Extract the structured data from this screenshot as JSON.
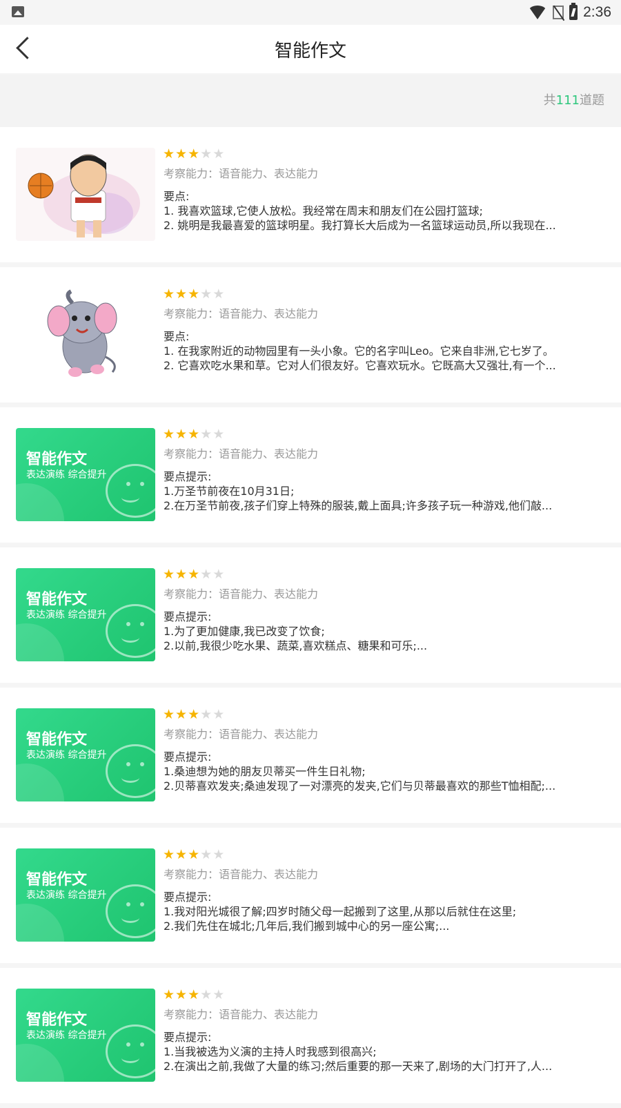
{
  "status_bar": {
    "time": "2:36",
    "icons": [
      "gallery-icon",
      "wifi-icon",
      "no-sim-icon",
      "battery-icon"
    ]
  },
  "header": {
    "title": "智能作文",
    "back_icon": "chevron-left-icon"
  },
  "summary": {
    "prefix": "共",
    "count": "111",
    "suffix": "道题"
  },
  "colors": {
    "accent": "#2ec77d",
    "star_active": "#f6b400",
    "star_inactive": "#d9d9d9"
  },
  "items": [
    {
      "thumb_type": "basketball-player-illustration",
      "rating": 3,
      "rating_max": 5,
      "skills": "考察能力：语音能力、表达能力",
      "heading": "要点:",
      "line1": "1. 我喜欢篮球,它使人放松。我经常在周末和朋友们在公园打篮球;",
      "line2": "2. 姚明是我最喜爱的篮球明星。我打算长大后成为一名篮球运动员,所以我现在..."
    },
    {
      "thumb_type": "elephant-illustration",
      "rating": 3,
      "rating_max": 5,
      "skills": "考察能力：语音能力、表达能力",
      "heading": "要点:",
      "line1": "1. 在我家附近的动物园里有一头小象。它的名字叫Leo。它来自非洲,它七岁了。",
      "line2": "2. 它喜欢吃水果和草。它对人们很友好。它喜欢玩水。它既高大又强壮,有一个..."
    },
    {
      "thumb_type": "green-banner",
      "thumb_title": "智能作文",
      "thumb_sub": "表达演练 综合提升",
      "rating": 3,
      "rating_max": 5,
      "skills": "考察能力：语音能力、表达能力",
      "heading": "要点提示:",
      "line1": "1.万圣节前夜在10月31日;",
      "line2": "2.在万圣节前夜,孩子们穿上特殊的服装,戴上面具;许多孩子玩一种游戏,他们敲..."
    },
    {
      "thumb_type": "green-banner",
      "thumb_title": "智能作文",
      "thumb_sub": "表达演练 综合提升",
      "rating": 3,
      "rating_max": 5,
      "skills": "考察能力：语音能力、表达能力",
      "heading": "要点提示:",
      "line1": "1.为了更加健康,我已改变了饮食;",
      "line2": "2.以前,我很少吃水果、蔬菜,喜欢糕点、糖果和可乐;..."
    },
    {
      "thumb_type": "green-banner",
      "thumb_title": "智能作文",
      "thumb_sub": "表达演练 综合提升",
      "rating": 3,
      "rating_max": 5,
      "skills": "考察能力：语音能力、表达能力",
      "heading": "要点提示:",
      "line1": "1.桑迪想为她的朋友贝蒂买一件生日礼物;",
      "line2": "2.贝蒂喜欢发夹;桑迪发现了一对漂亮的发夹,它们与贝蒂最喜欢的那些T恤相配;..."
    },
    {
      "thumb_type": "green-banner",
      "thumb_title": "智能作文",
      "thumb_sub": "表达演练 综合提升",
      "rating": 3,
      "rating_max": 5,
      "skills": "考察能力：语音能力、表达能力",
      "heading": "要点提示:",
      "line1": "1.我对阳光城很了解;四岁时随父母一起搬到了这里,从那以后就住在这里;",
      "line2": "2.我们先住在城北;几年后,我们搬到城中心的另一座公寓;..."
    },
    {
      "thumb_type": "green-banner",
      "thumb_title": "智能作文",
      "thumb_sub": "表达演练 综合提升",
      "rating": 3,
      "rating_max": 5,
      "skills": "考察能力：语音能力、表达能力",
      "heading": "要点提示:",
      "line1": "1.当我被选为义演的主持人时我感到很高兴;",
      "line2": "2.在演出之前,我做了大量的练习;然后重要的那一天来了,剧场的大门打开了,人..."
    }
  ]
}
